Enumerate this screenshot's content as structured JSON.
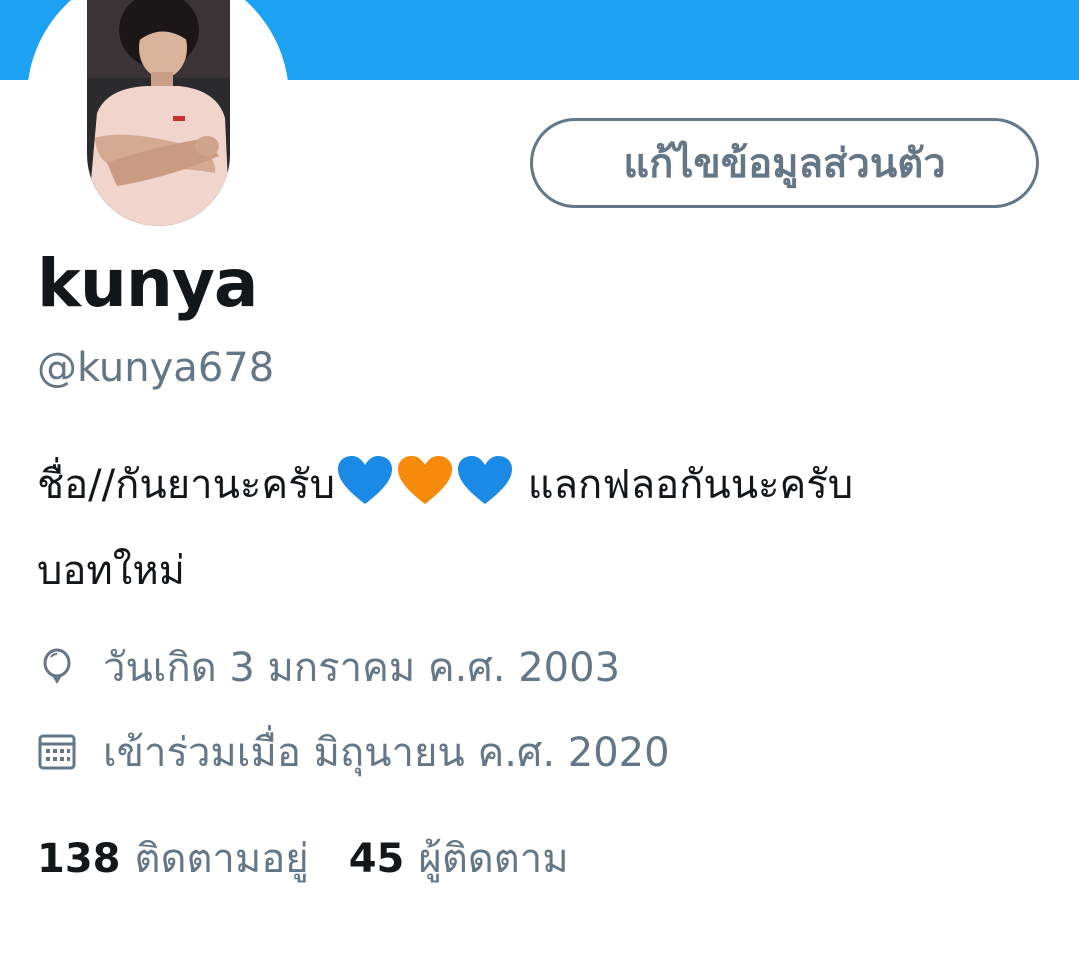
{
  "profile": {
    "edit_button_label": "แก้ไขข้อมูลส่วนตัว",
    "display_name": "kunya",
    "handle": "@kunya678",
    "bio_part1": "ชื่อ//กันยานะครับ",
    "bio_part2": " แลกฟลอกันนะครับ",
    "bio_line2": "บอทใหม่",
    "bio_hearts": [
      "blue-heart",
      "orange-heart",
      "blue-heart"
    ],
    "birthday": "วันเกิด 3 มกราคม ค.ศ. 2003",
    "joined": "เข้าร่วมเมื่อ มิถุนายน ค.ศ. 2020",
    "following_count": "138",
    "following_label": "ติดตามอยู่",
    "followers_count": "45",
    "followers_label": "ผู้ติดตาม"
  },
  "icons": {
    "birthday": "balloon-icon",
    "joined": "calendar-icon"
  },
  "colors": {
    "banner": "#1da1f2",
    "secondary_text": "#657786",
    "primary_text": "#14171a",
    "blue_heart": "#1a8ae6",
    "orange_heart": "#f58a0b"
  }
}
